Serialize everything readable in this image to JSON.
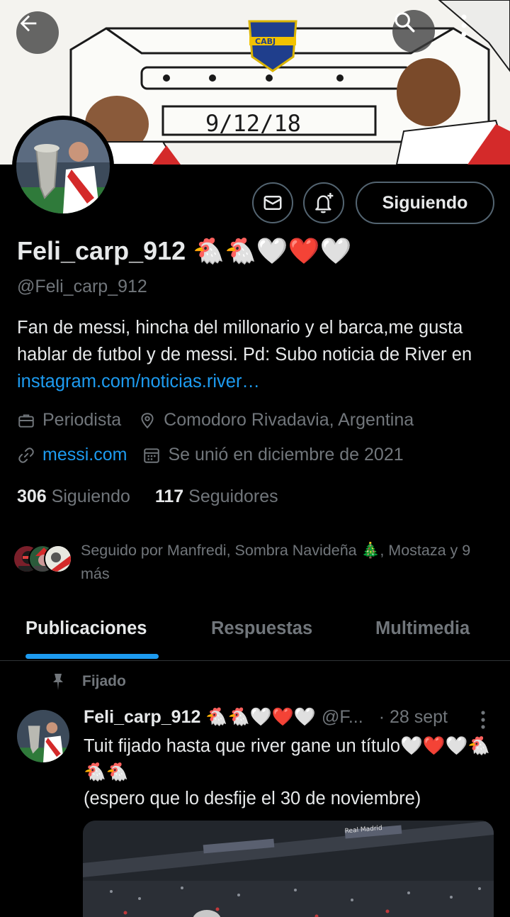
{
  "header": {
    "banner_text": "9/12/18",
    "crest_text": "CABJ",
    "back_icon": "arrow-left-icon",
    "search_icon": "search-icon",
    "more_icon": "more-vertical-icon"
  },
  "actions": {
    "message_icon": "envelope-icon",
    "notify_icon": "bell-plus-icon",
    "follow_label": "Siguiendo"
  },
  "profile": {
    "display_name": "Feli_carp_912 🐔🐔🤍❤️🤍",
    "handle": "@Feli_carp_912",
    "bio_text": "Fan de messi, hincha del millonario y el barca,me gusta hablar de futbol y de messi. Pd: Subo noticia de River en ",
    "bio_link": "instagram.com/noticias.river…",
    "profession": "Periodista",
    "location": "Comodoro Rivadavia, Argentina",
    "website": "messi.com",
    "joined": "Se unió en diciembre de 2021",
    "following_count": "306",
    "following_label": "Siguiendo",
    "followers_count": "117",
    "followers_label": "Seguidores",
    "followed_by": "Seguido por Manfredi, Sombra Navideña 🎄, Mostaza y 9 más"
  },
  "tabs": [
    {
      "label": "Publicaciones",
      "active": true
    },
    {
      "label": "Respuestas",
      "active": false
    },
    {
      "label": "Multimedia",
      "active": false
    }
  ],
  "post": {
    "pinned_label": "Fijado",
    "author": "Feli_carp_912 🐔🐔🤍❤️🤍",
    "handle": "@F...",
    "date": "· 28 sept",
    "text_line1": "Tuit fijado hasta que river gane un título🤍❤️🤍🐔🐔🐔",
    "text_line2": "(espero que lo desfije el 30 de noviembre)",
    "media_text": "Real Madrid"
  },
  "colors": {
    "background": "#000000",
    "text": "#e7e9ea",
    "muted": "#71767b",
    "accent": "#1d9bf0",
    "border": "#536471"
  }
}
